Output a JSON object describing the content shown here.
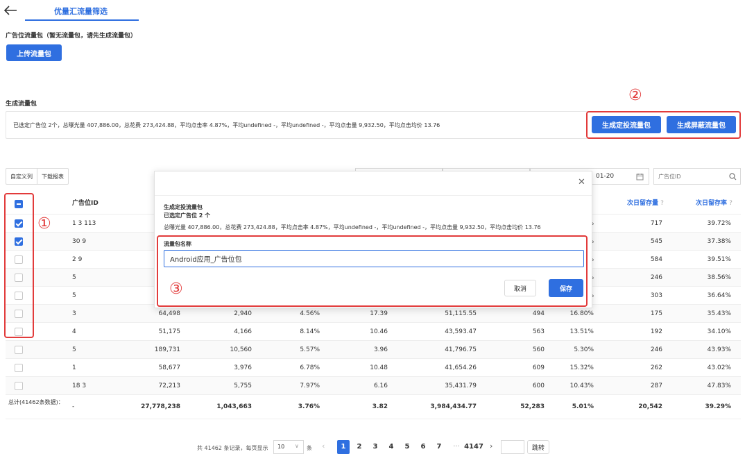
{
  "header": {
    "back_icon": "arrow-left-icon",
    "tab_label": "优量汇流量筛选"
  },
  "upload_section": {
    "title": "广告位流量包（暂无流量包，请先生成流量包）",
    "button_label": "上传流量包"
  },
  "generate_section": {
    "title": "生成流量包",
    "summary": "已选定广告位 2个，总曝光量 407,886.00，总花费 273,424.88，平均点击率 4.87%，平均undefined -，平均undefined -，平均点击量 9,932.50，平均点击均价 13.76",
    "targeted_button": "生成定投流量包",
    "blocked_button": "生成屏蔽流量包"
  },
  "toolbar": {
    "custom_columns": "自定义列",
    "download_report": "下载报表",
    "date_value": "01-20",
    "search_placeholder": "广告位ID"
  },
  "table": {
    "col_id_header": "广告位ID",
    "col_retention_header": "次日留存量",
    "col_retention_rate_header": "次日留存率",
    "rows": [
      {
        "id": "1 3 113",
        "checked": true,
        "c1": "",
        "c2": "",
        "c3": "",
        "c4": "",
        "c5": "",
        "c6": "",
        "c7": "%",
        "c8": "717",
        "c9": "39.72%"
      },
      {
        "id": "30 9",
        "checked": true,
        "c1": "",
        "c2": "",
        "c3": "",
        "c4": "",
        "c5": "",
        "c6": "",
        "c7": "%",
        "c8": "545",
        "c9": "37.38%"
      },
      {
        "id": "2 9",
        "checked": false,
        "c1": "",
        "c2": "",
        "c3": "",
        "c4": "",
        "c5": "",
        "c6": "",
        "c7": "%",
        "c8": "584",
        "c9": "39.51%"
      },
      {
        "id": "5",
        "checked": false,
        "c1": "",
        "c2": "",
        "c3": "",
        "c4": "",
        "c5": "",
        "c6": "",
        "c7": "%",
        "c8": "246",
        "c9": "38.56%"
      },
      {
        "id": "5",
        "checked": false,
        "c1": "",
        "c2": "",
        "c3": "",
        "c4": "",
        "c5": "",
        "c6": "",
        "c7": "%",
        "c8": "303",
        "c9": "36.64%"
      },
      {
        "id": "3",
        "checked": false,
        "c1": "64,498",
        "c2": "2,940",
        "c3": "4.56%",
        "c4": "17.39",
        "c5": "51,115.55",
        "c6": "494",
        "c7": "16.80%",
        "c8": "175",
        "c9": "35.43%"
      },
      {
        "id": "4",
        "checked": false,
        "c1": "51,175",
        "c2": "4,166",
        "c3": "8.14%",
        "c4": "10.46",
        "c5": "43,593.47",
        "c6": "563",
        "c7": "13.51%",
        "c8": "192",
        "c9": "34.10%"
      },
      {
        "id": "5",
        "checked": false,
        "c1": "189,731",
        "c2": "10,560",
        "c3": "5.57%",
        "c4": "3.96",
        "c5": "41,796.75",
        "c6": "560",
        "c7": "5.30%",
        "c8": "246",
        "c9": "43.93%"
      },
      {
        "id": "1",
        "checked": false,
        "c1": "58,677",
        "c2": "3,976",
        "c3": "6.78%",
        "c4": "10.48",
        "c5": "41,654.26",
        "c6": "609",
        "c7": "15.32%",
        "c8": "262",
        "c9": "43.02%"
      },
      {
        "id": "18 3",
        "checked": false,
        "c1": "72,213",
        "c2": "5,755",
        "c3": "7.97%",
        "c4": "6.16",
        "c5": "35,431.79",
        "c6": "600",
        "c7": "10.43%",
        "c8": "287",
        "c9": "47.83%"
      }
    ],
    "total": {
      "label": "总计(41462条数据)：",
      "id": "-",
      "c1": "27,778,238",
      "c2": "1,043,663",
      "c3": "3.76%",
      "c4": "3.82",
      "c5": "3,984,434.77",
      "c6": "52,283",
      "c7": "5.01%",
      "c8": "20,542",
      "c9": "39.29%"
    }
  },
  "pagination": {
    "total_text": "共 41462 条记录，每页显示",
    "page_size": "10",
    "unit": "条",
    "pages": [
      "1",
      "2",
      "3",
      "4",
      "5",
      "6",
      "7"
    ],
    "ellipsis": "···",
    "last_page": "4147",
    "jump_label": "跳转"
  },
  "modal": {
    "title": "生成定投流量包",
    "selected_line": "已选定广告位 2 个",
    "summary": "总曝光量 407,886.00，总花费 273,424.88，平均点击率 4.87%，平均undefined -，平均undefined -，平均点击量 9,932.50，平均点击均价 13.76",
    "name_label": "流量包名称",
    "name_value": "Android应用_广告位包",
    "cancel_label": "取消",
    "save_label": "保存"
  },
  "annotations": {
    "a1": "①",
    "a2": "②",
    "a3": "③"
  },
  "colors": {
    "accent": "#2f6fe0",
    "annotation_red": "#e23b3b"
  }
}
